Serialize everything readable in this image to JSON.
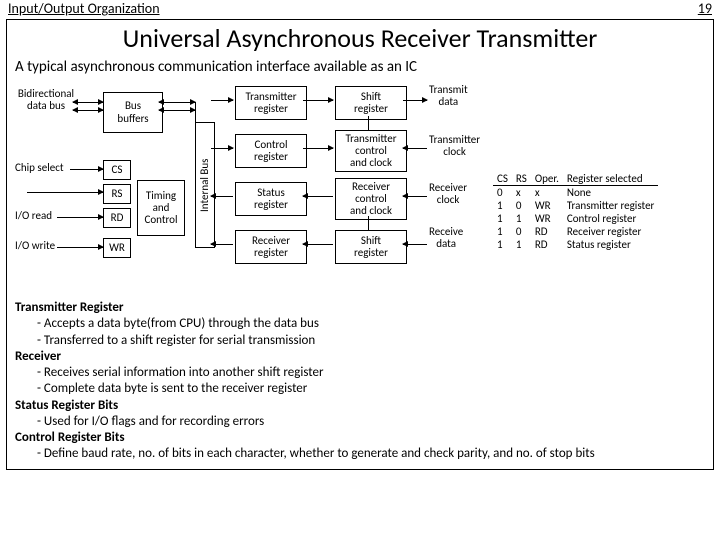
{
  "header": {
    "left": "Input/Output Organization",
    "right": "19"
  },
  "title": "Universal Asynchronous Receiver Transmitter",
  "intro": "A typical asynchronous communication interface available as an IC",
  "labels": {
    "bidir": "Bidirectional\ndata bus",
    "chipsel": "Chip select",
    "ioread": "I/O read",
    "iowrite": "I/O write",
    "busbuf": "Bus\nbuffers",
    "cs": "CS",
    "rs": "RS",
    "rd": "RD",
    "wr": "WR",
    "timing": "Timing\nand\nControl",
    "intbus": "Internal Bus",
    "txreg": "Transmitter\nregister",
    "ctlreg": "Control\nregister",
    "statreg": "Status\nregister",
    "rxreg": "Receiver\nregister",
    "shiftreg1": "Shift\nregister",
    "txctrl": "Transmitter\ncontrol\nand clock",
    "rxctrl": "Receiver\ncontrol\nand clock",
    "shiftreg2": "Shift\nregister",
    "txdata": "Transmit\ndata",
    "txclk": "Transmitter\nclock",
    "rxclk": "Receiver\nclock",
    "rxdata": "Receive\ndata"
  },
  "table": {
    "headers": [
      "CS",
      "RS",
      "Oper.",
      "Register selected"
    ],
    "rows": [
      [
        "0",
        "x",
        "x",
        "None"
      ],
      [
        "1",
        "0",
        "WR",
        "Transmitter register"
      ],
      [
        "1",
        "1",
        "WR",
        "Control register"
      ],
      [
        "1",
        "0",
        "RD",
        "Receiver register"
      ],
      [
        "1",
        "1",
        "RD",
        "Status register"
      ]
    ]
  },
  "desc": {
    "h1": "Transmitter Register",
    "b1a": "- Accepts a data byte(from CPU) through the data bus",
    "b1b": "- Transferred to a shift register for serial transmission",
    "h2": "Receiver",
    "b2a": "- Receives serial information into another shift register",
    "b2b": "- Complete data byte is sent to the receiver register",
    "h3": "Status Register Bits",
    "b3a": "- Used for I/O flags and for recording errors",
    "h4": "Control Register Bits",
    "b4a": "- Define baud rate, no. of bits in each character, whether to generate and check parity, and no. of stop bits"
  }
}
